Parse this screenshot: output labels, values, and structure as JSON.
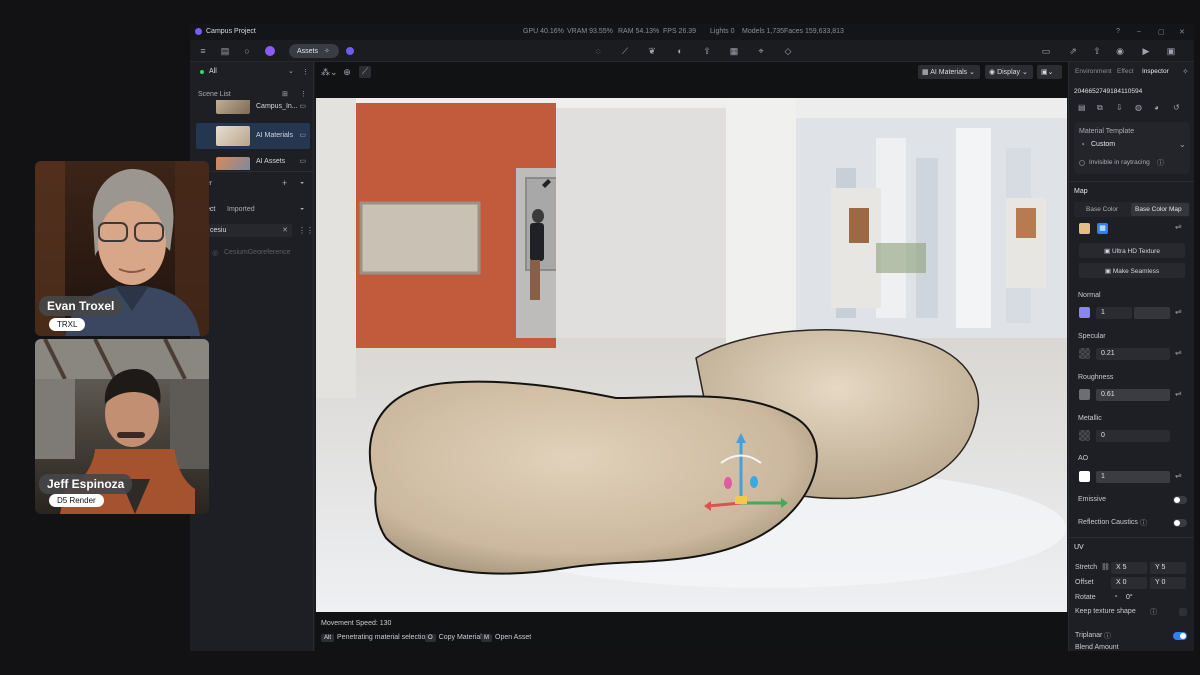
{
  "app": {
    "title": "Campus Project",
    "stats": {
      "gpu": "GPU 40.16%",
      "vram": "VRAM 93.55%",
      "ram": "RAM 54.13%",
      "fps": "FPS 26.39",
      "lights": "Lights 0",
      "models": "Models 1,735",
      "faces": "Faces 159,633,813"
    }
  },
  "toolbar": {
    "assets_label": "Assets"
  },
  "left_panel": {
    "filter_label": "All",
    "scene_list_title": "Scene List",
    "scene_items": [
      {
        "name": "Campus_In..."
      },
      {
        "name": "AI Materials"
      },
      {
        "name": "AI Assets"
      }
    ],
    "layer_title": "er",
    "tabs": [
      "ect",
      "Imported"
    ],
    "search_value": "cesiu",
    "result_item": "CesiumGeoreference"
  },
  "viewport": {
    "top_buttons": [
      "AI Materials",
      "Display"
    ],
    "movement_speed": "Movement Speed: 130",
    "hints": [
      {
        "key": "Alt",
        "label": "Penetrating material selection"
      },
      {
        "key": "O",
        "label": "Copy Material"
      },
      {
        "key": "M",
        "label": "Open Asset"
      }
    ]
  },
  "inspector": {
    "tabs": [
      "Environment",
      "Effect",
      "Inspector"
    ],
    "object_id": "2046652749184110594",
    "material_template_label": "Material Template",
    "material_template_value": "Custom",
    "invisible_label": "Invisible in raytracing",
    "map_section": "Map",
    "map_tabs": [
      "Base Color",
      "Base Color Map"
    ],
    "ultra_hd_label": "Ultra HD Texture",
    "make_seamless_label": "Make Seamless",
    "normal_label": "Normal",
    "normal_value": "1",
    "specular_label": "Specular",
    "specular_value": "0.21",
    "roughness_label": "Roughness",
    "roughness_value": "0.61",
    "metallic_label": "Metallic",
    "metallic_value": "0",
    "ao_label": "AO",
    "ao_value": "1",
    "emissive_label": "Emissive",
    "emissive_on": false,
    "reflection_caustics_label": "Reflection Caustics",
    "reflection_caustics_on": false,
    "uv_section": "UV",
    "stretch_label": "Stretch",
    "stretch_x": "X 5",
    "stretch_y": "Y 5",
    "offset_label": "Offset",
    "offset_x": "X 0",
    "offset_y": "Y 0",
    "rotate_label": "Rotate",
    "rotate_value": "0°",
    "keep_texture_label": "Keep texture shape",
    "triplanar_label": "Triplanar",
    "triplanar_on": true,
    "blend_amount_label": "Blend Amount"
  },
  "participants": [
    {
      "name": "Evan Troxel",
      "subtitle": "TRXL"
    },
    {
      "name": "Jeff Espinoza",
      "subtitle": "D5 Render"
    }
  ],
  "colors": {
    "accent": "#2f7ff5",
    "base_color_swatch": "#e3bf86",
    "normal_swatch": "#8a86f0"
  }
}
